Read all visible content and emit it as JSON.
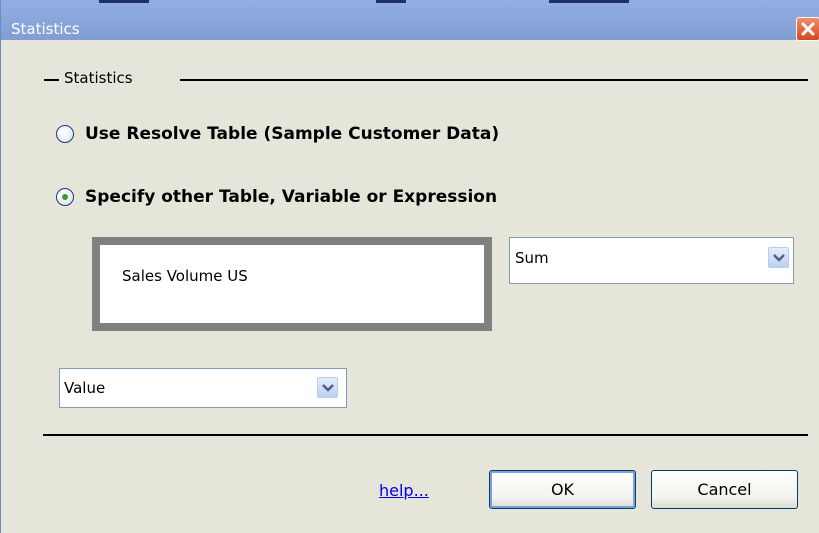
{
  "window": {
    "title": "Statistics",
    "close_icon": "close-icon"
  },
  "group": {
    "title": "Statistics"
  },
  "options": {
    "resolve_label": "Use Resolve Table (Sample Customer Data)",
    "resolve_selected": false,
    "specify_label": "Specify other Table, Variable or Expression",
    "specify_selected": true
  },
  "expression": {
    "value": "Sales Volume US"
  },
  "aggregate": {
    "selected": "Sum"
  },
  "value_select": {
    "selected": "Value"
  },
  "footer": {
    "help_label": "help...",
    "ok_label": "OK",
    "cancel_label": "Cancel"
  },
  "colors": {
    "title_bar": "#8aa6dc",
    "dialog_bg": "#e6e5da",
    "link": "#0000ee",
    "radio_selected_dot": "#3a9a2f"
  }
}
